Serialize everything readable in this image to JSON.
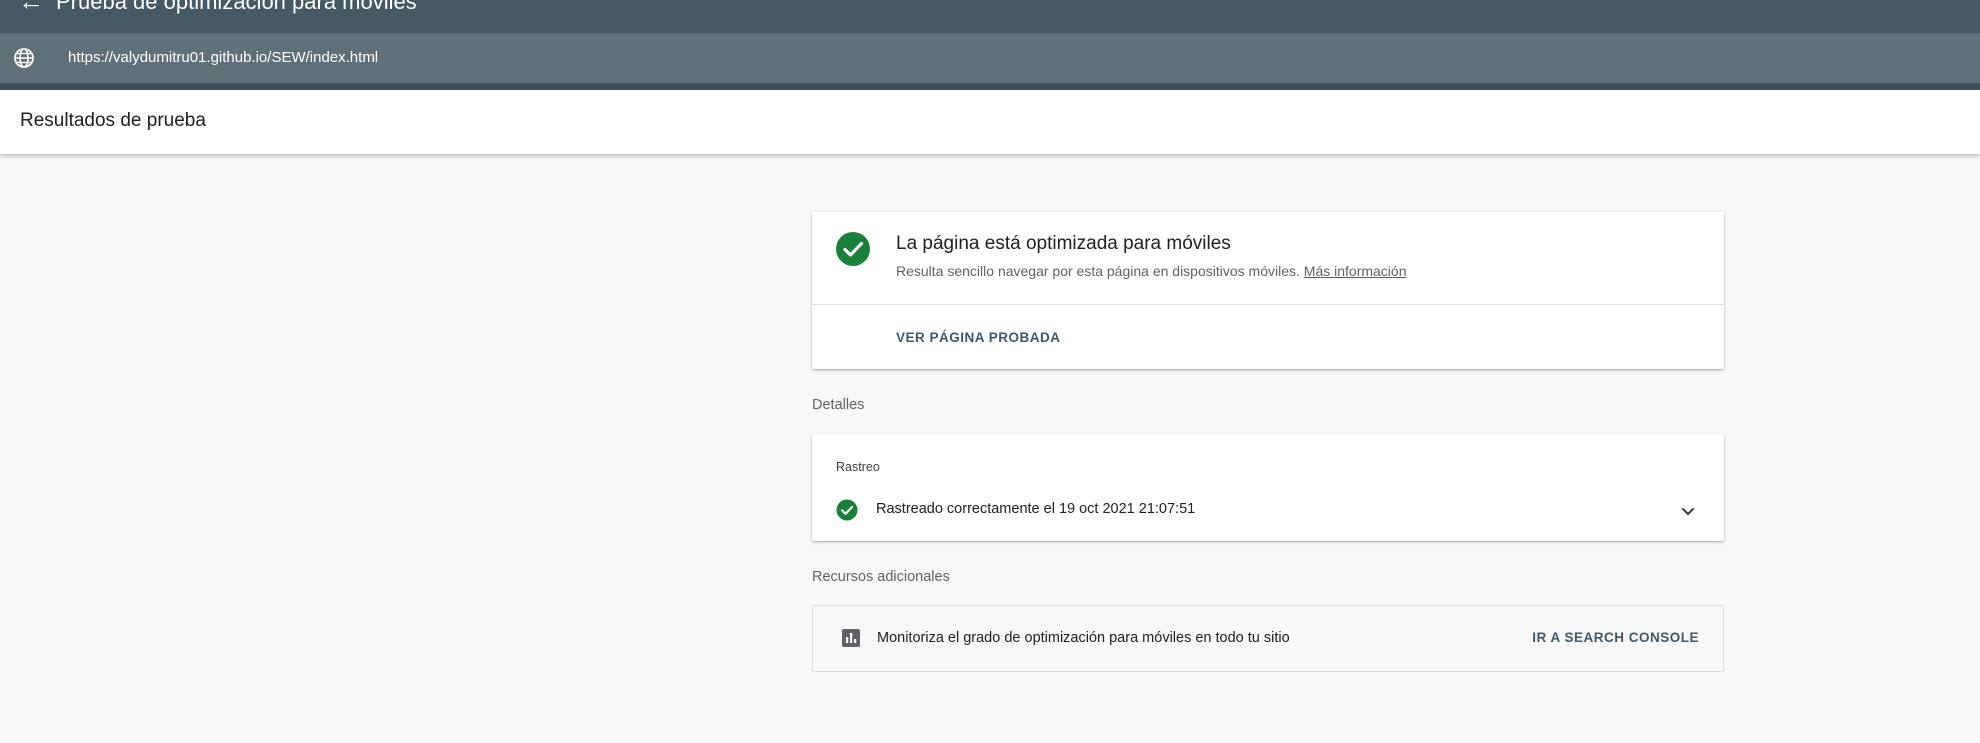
{
  "app": {
    "title": "Prueba de optimización para móviles",
    "back_icon": "arrow-back-icon"
  },
  "urlbar": {
    "icon": "globe-icon",
    "url": "https://valydumitru01.github.io/SEW/index.html"
  },
  "header": {
    "title": "Resultados de prueba"
  },
  "result": {
    "status_icon": "check-circle-icon",
    "title": "La página está optimizada para móviles",
    "description": "Resulta sencillo navegar por esta página en dispositivos móviles.",
    "more_info_link": "Más información",
    "view_button": "VER PÁGINA PROBADA"
  },
  "details": {
    "label": "Detalles",
    "crawl": {
      "section": "Rastreo",
      "status_icon": "check-circle-icon",
      "text": "Rastreado correctamente el 19 oct 2021 21:07:51",
      "expand_icon": "chevron-down-icon"
    }
  },
  "resources": {
    "label": "Recursos adicionales",
    "icon": "bar-chart-icon",
    "text": "Monitoriza el grado de optimización para móviles en todo tu sitio",
    "button": "IR A SEARCH CONSOLE"
  },
  "colors": {
    "topbar": "#455a64",
    "urlbar": "#607079",
    "success": "#188038",
    "accent": "#3f5968"
  }
}
